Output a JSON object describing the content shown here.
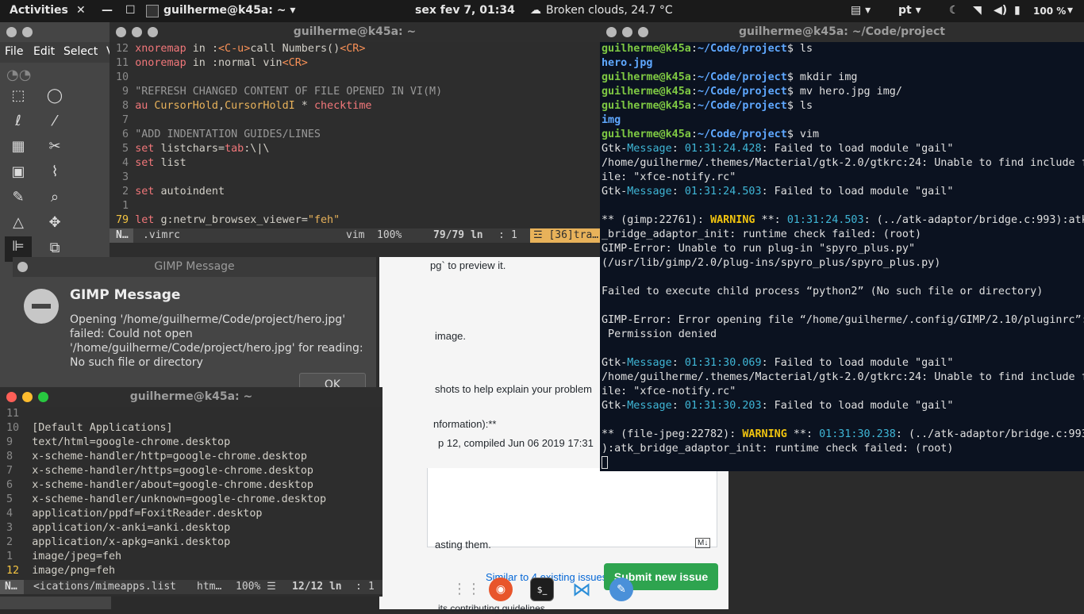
{
  "topbar": {
    "activities": "Activities",
    "terminal_app": "guilherme@k45a: ~",
    "clock": "sex fev  7, 01:34",
    "weather": "Broken clouds, 24.7 °C",
    "lang": "pt",
    "battery": "100 %"
  },
  "gimp_bg": {
    "menu": [
      "File",
      "Edit",
      "Select",
      "V"
    ]
  },
  "vim_top": {
    "title": "guilherme@k45a: ~",
    "lines": [
      {
        "n": "12",
        "parts": [
          {
            "t": "xnoremap ",
            "c": "kw"
          },
          {
            "t": "in ",
            "c": ""
          },
          {
            "t": ":",
            "c": ""
          },
          {
            "t": "<C-u>",
            "c": "orange"
          },
          {
            "t": "call Numbers()",
            "c": ""
          },
          {
            "t": "<CR>",
            "c": "orange"
          }
        ]
      },
      {
        "n": "11",
        "parts": [
          {
            "t": "onoremap ",
            "c": "kw"
          },
          {
            "t": "in ",
            "c": ""
          },
          {
            "t": ":normal vin",
            "c": ""
          },
          {
            "t": "<CR>",
            "c": "orange"
          }
        ]
      },
      {
        "n": "10",
        "parts": []
      },
      {
        "n": "9",
        "parts": [
          {
            "t": "\"REFRESH CHANGED CONTENT OF FILE OPENED IN VI(M)",
            "c": "cm"
          }
        ]
      },
      {
        "n": "8",
        "parts": [
          {
            "t": "au ",
            "c": "kw"
          },
          {
            "t": "CursorHold",
            "c": "str"
          },
          {
            "t": ",",
            "c": ""
          },
          {
            "t": "CursorHoldI",
            "c": "str"
          },
          {
            "t": " * ",
            "c": ""
          },
          {
            "t": "checktime",
            "c": "kw"
          }
        ]
      },
      {
        "n": "7",
        "parts": []
      },
      {
        "n": "6",
        "parts": [
          {
            "t": "\"ADD INDENTATION GUIDES/LINES",
            "c": "cm"
          }
        ]
      },
      {
        "n": "5",
        "parts": [
          {
            "t": "set ",
            "c": "kw"
          },
          {
            "t": "listchars",
            "c": ""
          },
          {
            "t": "=",
            "c": ""
          },
          {
            "t": "tab",
            "c": "kw"
          },
          {
            "t": ":\\|\\",
            "c": ""
          }
        ]
      },
      {
        "n": "4",
        "parts": [
          {
            "t": "set ",
            "c": "kw"
          },
          {
            "t": "list",
            "c": ""
          }
        ]
      },
      {
        "n": "3",
        "parts": []
      },
      {
        "n": "2",
        "parts": [
          {
            "t": "set ",
            "c": "kw"
          },
          {
            "t": "autoindent",
            "c": ""
          }
        ]
      },
      {
        "n": "1",
        "parts": []
      },
      {
        "n": "79",
        "cur": true,
        "parts": [
          {
            "t": "let ",
            "c": "kw"
          },
          {
            "t": "g:netrw_browsex_viewer",
            "c": ""
          },
          {
            "t": "=",
            "c": ""
          },
          {
            "t": "\"feh\"",
            "c": "str"
          }
        ]
      }
    ],
    "status": {
      "mode": "N…",
      "file": ".vimrc",
      "ft": "vim",
      "pct": "100%",
      "pos": "79/79 ln",
      "col": "1",
      "extra": "☲ [36]tra…"
    }
  },
  "term_right": {
    "title": "guilherme@k45a: ~/Code/project",
    "lines": [
      [
        {
          "t": "guilherme@k45a",
          "c": "g"
        },
        {
          "t": ":",
          "c": ""
        },
        {
          "t": "~/Code/project",
          "c": "b"
        },
        {
          "t": "$ ls",
          "c": ""
        }
      ],
      [
        {
          "t": "hero.jpg",
          "c": "b"
        }
      ],
      [
        {
          "t": "guilherme@k45a",
          "c": "g"
        },
        {
          "t": ":",
          "c": ""
        },
        {
          "t": "~/Code/project",
          "c": "b"
        },
        {
          "t": "$ mkdir img",
          "c": ""
        }
      ],
      [
        {
          "t": "guilherme@k45a",
          "c": "g"
        },
        {
          "t": ":",
          "c": ""
        },
        {
          "t": "~/Code/project",
          "c": "b"
        },
        {
          "t": "$ mv hero.jpg img/",
          "c": ""
        }
      ],
      [
        {
          "t": "guilherme@k45a",
          "c": "g"
        },
        {
          "t": ":",
          "c": ""
        },
        {
          "t": "~/Code/project",
          "c": "b"
        },
        {
          "t": "$ ls",
          "c": ""
        }
      ],
      [
        {
          "t": "img",
          "c": "b"
        }
      ],
      [
        {
          "t": "guilherme@k45a",
          "c": "g"
        },
        {
          "t": ":",
          "c": ""
        },
        {
          "t": "~/Code/project",
          "c": "b"
        },
        {
          "t": "$ vim",
          "c": ""
        }
      ],
      [
        {
          "t": "Gtk-",
          "c": ""
        },
        {
          "t": "Message",
          "c": "c"
        },
        {
          "t": ": ",
          "c": ""
        },
        {
          "t": "01:31:24.428",
          "c": "c"
        },
        {
          "t": ": Failed to load module \"gail\"",
          "c": ""
        }
      ],
      [
        {
          "t": "/home/guilherme/.themes/Macterial/gtk-2.0/gtkrc:24: Unable to find include f",
          "c": ""
        }
      ],
      [
        {
          "t": "ile: \"xfce-notify.rc\"",
          "c": ""
        }
      ],
      [
        {
          "t": "Gtk-",
          "c": ""
        },
        {
          "t": "Message",
          "c": "c"
        },
        {
          "t": ": ",
          "c": ""
        },
        {
          "t": "01:31:24.503",
          "c": "c"
        },
        {
          "t": ": Failed to load module \"gail\"",
          "c": ""
        }
      ],
      [],
      [
        {
          "t": "** (gimp:22761): ",
          "c": ""
        },
        {
          "t": "WARNING",
          "c": "y"
        },
        {
          "t": " **: ",
          "c": ""
        },
        {
          "t": "01:31:24.503",
          "c": "c"
        },
        {
          "t": ": (../atk-adaptor/bridge.c:993):atk",
          "c": ""
        }
      ],
      [
        {
          "t": "_bridge_adaptor_init: runtime check failed: (root)",
          "c": ""
        }
      ],
      [
        {
          "t": "GIMP-Error: Unable to run plug-in \"spyro_plus.py\"",
          "c": ""
        }
      ],
      [
        {
          "t": "(/usr/lib/gimp/2.0/plug-ins/spyro_plus/spyro_plus.py)",
          "c": ""
        }
      ],
      [],
      [
        {
          "t": "Failed to execute child process “python2” (No such file or directory)",
          "c": ""
        }
      ],
      [],
      [
        {
          "t": "GIMP-Error: Error opening file “/home/guilherme/.config/GIMP/2.10/pluginrc”:",
          "c": ""
        }
      ],
      [
        {
          "t": " Permission denied",
          "c": ""
        }
      ],
      [],
      [
        {
          "t": "Gtk-",
          "c": ""
        },
        {
          "t": "Message",
          "c": "c"
        },
        {
          "t": ": ",
          "c": ""
        },
        {
          "t": "01:31:30.069",
          "c": "c"
        },
        {
          "t": ": Failed to load module \"gail\"",
          "c": ""
        }
      ],
      [
        {
          "t": "/home/guilherme/.themes/Macterial/gtk-2.0/gtkrc:24: Unable to find include f",
          "c": ""
        }
      ],
      [
        {
          "t": "ile: \"xfce-notify.rc\"",
          "c": ""
        }
      ],
      [
        {
          "t": "Gtk-",
          "c": ""
        },
        {
          "t": "Message",
          "c": "c"
        },
        {
          "t": ": ",
          "c": ""
        },
        {
          "t": "01:31:30.203",
          "c": "c"
        },
        {
          "t": ": Failed to load module \"gail\"",
          "c": ""
        }
      ],
      [],
      [
        {
          "t": "** (file-jpeg:22782): ",
          "c": ""
        },
        {
          "t": "WARNING",
          "c": "y"
        },
        {
          "t": " **: ",
          "c": ""
        },
        {
          "t": "01:31:30.238",
          "c": "c"
        },
        {
          "t": ": (../atk-adaptor/bridge.c:993",
          "c": ""
        }
      ],
      [
        {
          "t": "):atk_bridge_adaptor_init: runtime check failed: (root)",
          "c": ""
        }
      ]
    ]
  },
  "gimp_msg": {
    "window_title": "GIMP Message",
    "heading": "GIMP Message",
    "body": "Opening '/home/guilherme/Code/project/hero.jpg' failed: Could not open '/home/guilherme/Code/project/hero.jpg' for reading: No such file or directory",
    "ok": "OK"
  },
  "vim_bottom": {
    "title": "guilherme@k45a: ~",
    "lines": [
      {
        "n": "11",
        "text": ""
      },
      {
        "n": "10",
        "text": "[Default Applications]"
      },
      {
        "n": "9",
        "text": "text/html=google-chrome.desktop"
      },
      {
        "n": "8",
        "text": "x-scheme-handler/http=google-chrome.desktop"
      },
      {
        "n": "7",
        "text": "x-scheme-handler/https=google-chrome.desktop"
      },
      {
        "n": "6",
        "text": "x-scheme-handler/about=google-chrome.desktop"
      },
      {
        "n": "5",
        "text": "x-scheme-handler/unknown=google-chrome.desktop"
      },
      {
        "n": "4",
        "text": "application/ppdf=FoxitReader.desktop"
      },
      {
        "n": "3",
        "text": "application/x-anki=anki.desktop"
      },
      {
        "n": "2",
        "text": "application/x-apkg=anki.desktop"
      },
      {
        "n": "1",
        "text": "image/jpeg=feh"
      },
      {
        "n": "12",
        "text": "image/png=feh",
        "cur": true
      }
    ],
    "status": {
      "mode": "N…",
      "file": "<ications/mimeapps.list",
      "ft": "htm…",
      "pct": "100% ☰",
      "pos": "12/12 ln",
      "col": "1"
    }
  },
  "browser": {
    "t1": "pg` to preview it.",
    "t2": "image.",
    "t3": "shots to help explain your problem",
    "t4": "nformation):**",
    "t5": "p 12, compiled Jun 06 2019 17:31",
    "t6": "asting them.",
    "md": "M↓",
    "similar": "Similar to 4 existing issues",
    "submit": "Submit new issue",
    "footer": "its contributing guidelines"
  }
}
